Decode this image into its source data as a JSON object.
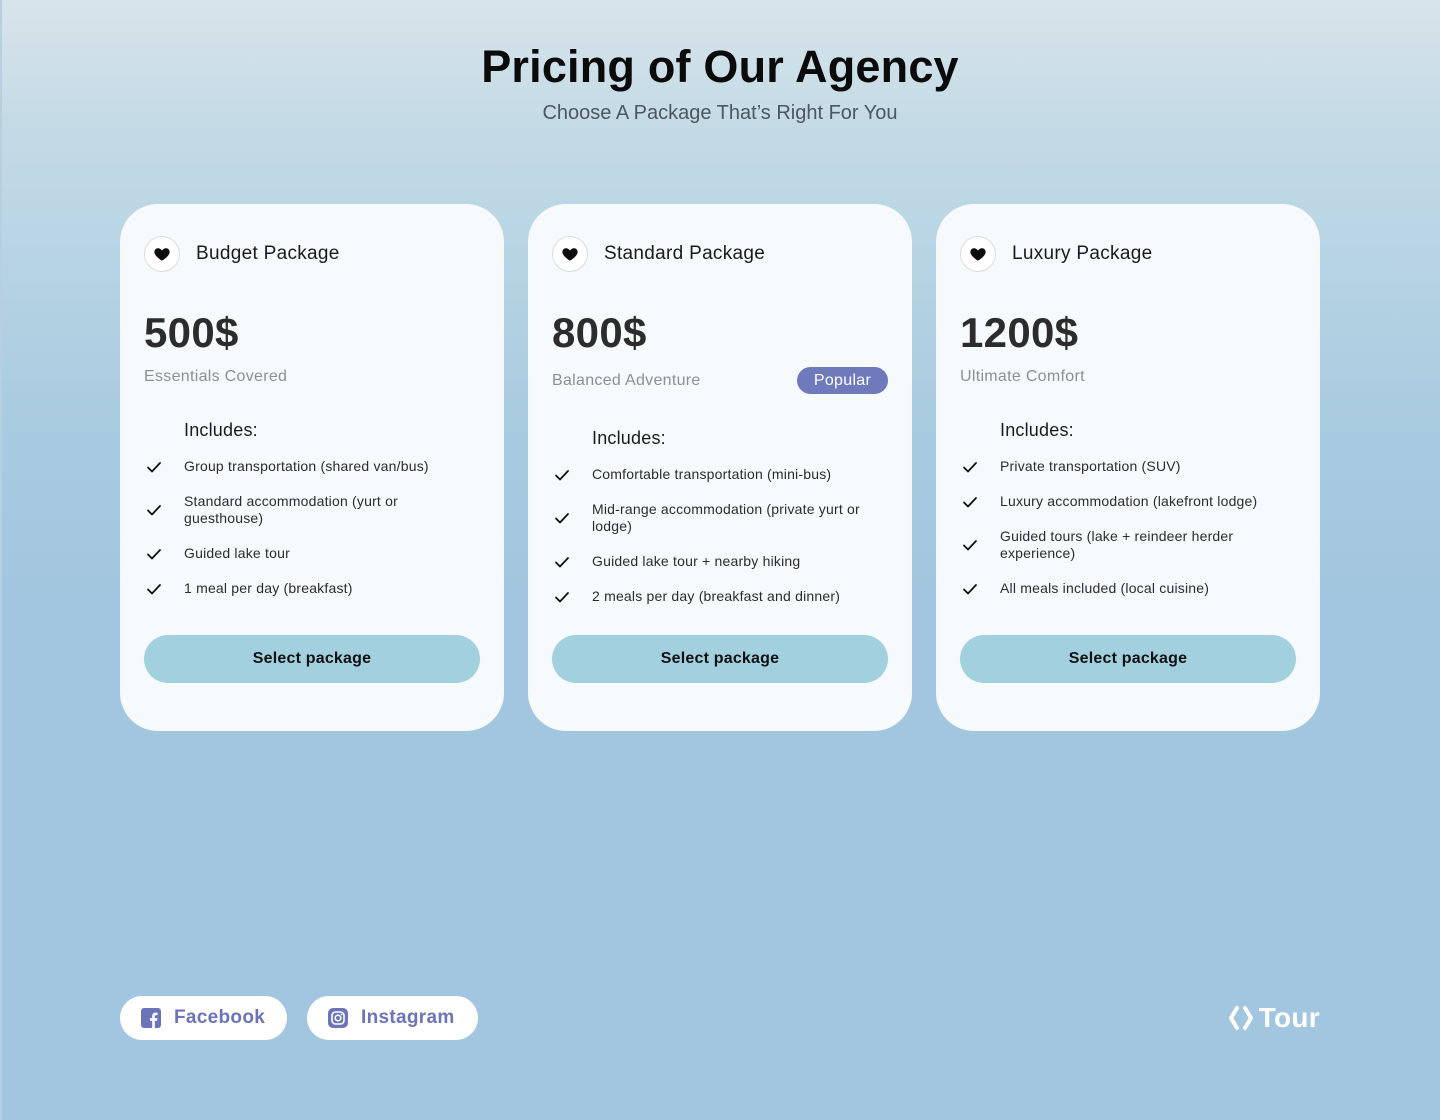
{
  "header": {
    "title": "Pricing of Our Agency",
    "subtitle": "Choose A Package That’s Right For You"
  },
  "cards": [
    {
      "name": "Budget Package",
      "price": "500$",
      "tagline": "Essentials Covered",
      "includes_title": "Includes:",
      "features": [
        "Group transportation (shared van/bus)",
        "Standard accommodation (yurt or guesthouse)",
        "Guided lake tour",
        "1 meal per day (breakfast)"
      ],
      "button_label": "Select package"
    },
    {
      "name": "Standard Package",
      "price": "800$",
      "tagline": "Balanced Adventure",
      "badge": "Popular",
      "includes_title": "Includes:",
      "features": [
        "Comfortable transportation (mini-bus)",
        "Mid-range accommodation (private yurt or lodge)",
        "Guided lake tour + nearby hiking",
        "2 meals per day (breakfast and dinner)"
      ],
      "button_label": "Select package"
    },
    {
      "name": "Luxury Package",
      "price": "1200$",
      "tagline": "Ultimate Comfort",
      "includes_title": "Includes:",
      "features": [
        "Private transportation (SUV)",
        "Luxury accommodation (lakefront lodge)",
        "Guided tours (lake + reindeer herder experience)",
        "All meals included (local cuisine)"
      ],
      "button_label": "Select package"
    }
  ],
  "footer": {
    "facebook_label": "Facebook",
    "instagram_label": "Instagram",
    "logo_text": "Tour"
  },
  "icons": {
    "card_icon": "heart-icon",
    "feature_icon": "check-icon",
    "facebook_icon": "facebook-icon",
    "instagram_icon": "instagram-icon",
    "logo_icon": "brackets-logo-icon"
  },
  "colors": {
    "accent": "#6e7abb",
    "button": "#a3d0df",
    "social_text": "#6b74b8",
    "card_bg": "#f7fafc"
  }
}
